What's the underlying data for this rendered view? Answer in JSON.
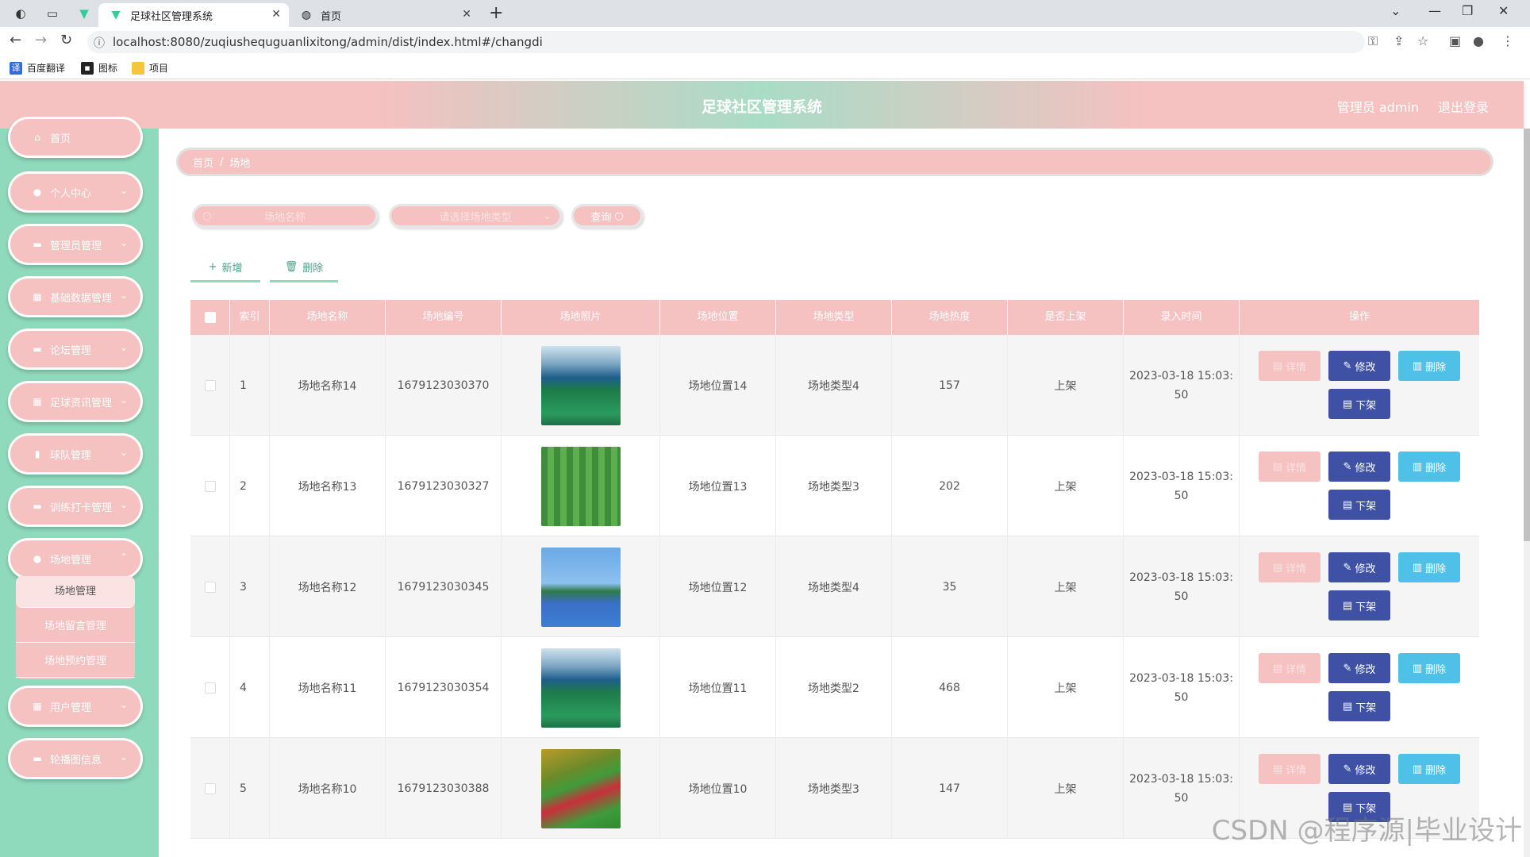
{
  "browser": {
    "tabs": [
      {
        "title": "足球社区管理系统",
        "active": true
      },
      {
        "title": "首页",
        "active": false
      }
    ],
    "url": "localhost:8080/zuqiushequguanlixitong/admin/dist/index.html#/changdi",
    "bookmarks": [
      {
        "label": "百度翻译",
        "icon": "translate-icon"
      },
      {
        "label": "图标",
        "icon": "image-icon"
      },
      {
        "label": "项目",
        "icon": "folder-icon"
      }
    ]
  },
  "header": {
    "title": "足球社区管理系统",
    "user": "管理员 admin",
    "logout": "退出登录"
  },
  "sidebar": {
    "items": [
      {
        "label": "首页",
        "icon": "home-icon"
      },
      {
        "label": "个人中心",
        "icon": "user-icon"
      },
      {
        "label": "管理员管理",
        "icon": "chat-icon"
      },
      {
        "label": "基础数据管理",
        "icon": "grid-icon"
      },
      {
        "label": "论坛管理",
        "icon": "monitor-icon"
      },
      {
        "label": "足球资讯管理",
        "icon": "grid-icon"
      },
      {
        "label": "球队管理",
        "icon": "bar-chart-icon"
      },
      {
        "label": "训练打卡管理",
        "icon": "chat-icon"
      },
      {
        "label": "场地管理",
        "icon": "user-icon"
      },
      {
        "label": "用户管理",
        "icon": "grid-icon"
      },
      {
        "label": "轮播图信息",
        "icon": "chat-icon"
      }
    ],
    "submenu": [
      "场地管理",
      "场地留言管理",
      "场地预约管理"
    ]
  },
  "breadcrumb": {
    "home": "首页",
    "sep": "/",
    "current": "场地"
  },
  "search": {
    "name_placeholder": "场地名称",
    "type_placeholder": "请选择场地类型",
    "query_label": "查询"
  },
  "actions": {
    "add": "新增",
    "delete": "删除"
  },
  "table": {
    "columns": [
      "索引",
      "场地名称",
      "场地编号",
      "场地照片",
      "场地位置",
      "场地类型",
      "场地热度",
      "是否上架",
      "录入时间",
      "操作"
    ],
    "ops": {
      "detail": "详情",
      "edit": "修改",
      "delete": "删除",
      "down": "下架"
    },
    "rows": [
      {
        "index": "1",
        "name": "场地名称14",
        "code": "1679123030370",
        "location": "场地位置14",
        "type": "场地类型4",
        "heat": "157",
        "status": "上架",
        "time1": "2023-03-18 15:03:",
        "time2": "50",
        "photo": "indoor"
      },
      {
        "index": "2",
        "name": "场地名称13",
        "code": "1679123030327",
        "location": "场地位置13",
        "type": "场地类型3",
        "heat": "202",
        "status": "上架",
        "time1": "2023-03-18 15:03:",
        "time2": "50",
        "photo": "stripes"
      },
      {
        "index": "3",
        "name": "场地名称12",
        "code": "1679123030345",
        "location": "场地位置12",
        "type": "场地类型4",
        "heat": "35",
        "status": "上架",
        "time1": "2023-03-18 15:03:",
        "time2": "50",
        "photo": "tennis"
      },
      {
        "index": "4",
        "name": "场地名称11",
        "code": "1679123030354",
        "location": "场地位置11",
        "type": "场地类型2",
        "heat": "468",
        "status": "上架",
        "time1": "2023-03-18 15:03:",
        "time2": "50",
        "photo": "indoor"
      },
      {
        "index": "5",
        "name": "场地名称10",
        "code": "1679123030388",
        "location": "场地位置10",
        "type": "场地类型3",
        "heat": "147",
        "status": "上架",
        "time1": "2023-03-18 15:03:",
        "time2": "50",
        "photo": "track"
      }
    ]
  },
  "watermark": "CSDN @程序源|毕业设计",
  "colors": {
    "pink": "#f5c1c1",
    "mint": "#8fdabc",
    "navy": "#3f51a5",
    "sky": "#4fc0e8"
  }
}
